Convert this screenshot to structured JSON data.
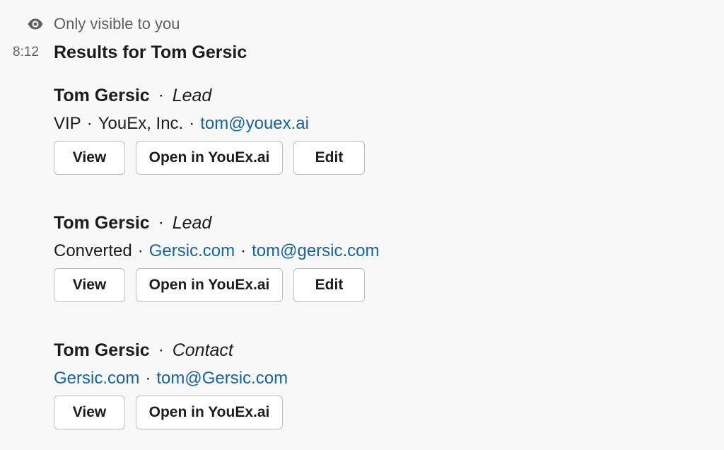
{
  "visibility_note": "Only visible to you",
  "message": {
    "timestamp": "8:12",
    "title": "Results for Tom Gersic"
  },
  "results": [
    {
      "name": "Tom Gersic",
      "dot": "·",
      "type": "Lead",
      "details": {
        "status": "VIP",
        "sep1": "·",
        "company": "YouEx, Inc.",
        "sep2": "·",
        "email": "tom@youex.ai"
      },
      "buttons": {
        "view": "View",
        "open": "Open in YouEx.ai",
        "edit": "Edit"
      }
    },
    {
      "name": "Tom Gersic",
      "dot": "·",
      "type": "Lead",
      "details": {
        "status": "Converted",
        "sep1": "·",
        "company": "Gersic.com",
        "sep2": "·",
        "email": "tom@gersic.com"
      },
      "buttons": {
        "view": "View",
        "open": "Open in YouEx.ai",
        "edit": "Edit"
      }
    },
    {
      "name": "Tom Gersic",
      "dot": "·",
      "type": "Contact",
      "details": {
        "company": "Gersic.com",
        "sep": "·",
        "email": "tom@Gersic.com"
      },
      "buttons": {
        "view": "View",
        "open": "Open in YouEx.ai"
      }
    }
  ],
  "icons": {
    "visibility": "eye-icon"
  },
  "colors": {
    "background": "#f8f8f8",
    "text": "#1d1c1d",
    "muted": "#616061",
    "link": "#1264a3",
    "button_border": "#bdbdbd"
  }
}
